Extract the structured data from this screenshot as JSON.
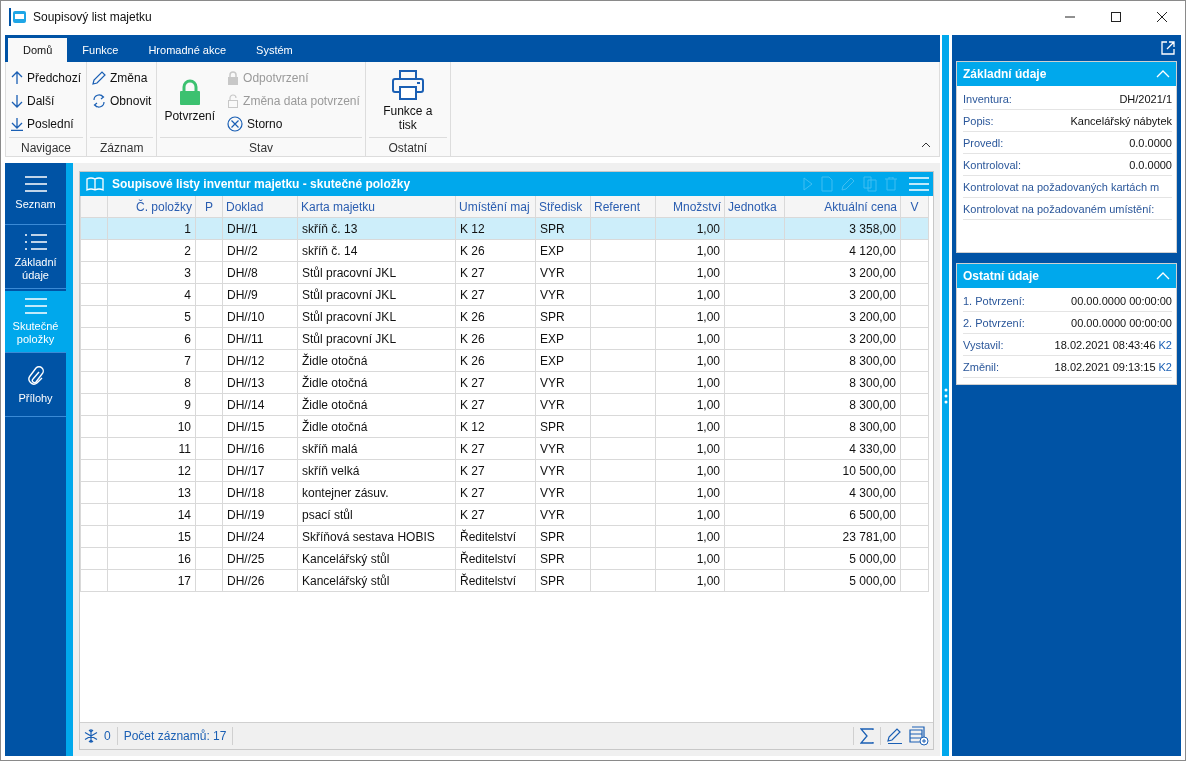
{
  "window": {
    "title": "Soupisový list majetku"
  },
  "tabs": [
    {
      "label": "Domů",
      "selected": true
    },
    {
      "label": "Funkce",
      "selected": false
    },
    {
      "label": "Hromadné akce",
      "selected": false
    },
    {
      "label": "Systém",
      "selected": false
    }
  ],
  "ribbon": {
    "groups": [
      {
        "label": "Navigace",
        "items": [
          {
            "label": "Předchozí",
            "kind": "small",
            "disabled": false
          },
          {
            "label": "Další",
            "kind": "small",
            "disabled": false
          },
          {
            "label": "Poslední",
            "kind": "small",
            "disabled": false
          }
        ]
      },
      {
        "label": "Záznam",
        "items": [
          {
            "label": "Změna",
            "kind": "small",
            "disabled": false
          },
          {
            "label": "Obnovit",
            "kind": "small",
            "disabled": false
          }
        ]
      },
      {
        "label": "Stav",
        "items": [
          {
            "label": "Potvrzení",
            "kind": "large",
            "disabled": false
          },
          {
            "label": "Odpotvrzení",
            "kind": "small",
            "disabled": true
          },
          {
            "label": "Změna data potvrzení",
            "kind": "small",
            "disabled": true
          },
          {
            "label": "Storno",
            "kind": "small",
            "disabled": false
          }
        ]
      },
      {
        "label": "Ostatní",
        "items": [
          {
            "label": "Funkce a tisk",
            "kind": "large",
            "disabled": false
          }
        ]
      }
    ]
  },
  "nav": [
    {
      "label": "Seznam",
      "selected": false
    },
    {
      "label": "Základní údaje",
      "selected": false
    },
    {
      "label": "Skutečné položky",
      "selected": true
    },
    {
      "label": "Přílohy",
      "selected": false
    }
  ],
  "grid": {
    "title": "Soupisové listy inventur majetku - skutečné položky",
    "columns": [
      {
        "label": "Č. položky"
      },
      {
        "label": "P"
      },
      {
        "label": "Doklad"
      },
      {
        "label": "Karta majetku"
      },
      {
        "label": "Umístění maj"
      },
      {
        "label": "Středisk"
      },
      {
        "label": "Referent"
      },
      {
        "label": "Množství"
      },
      {
        "label": "Jednotka"
      },
      {
        "label": "Aktuální cena"
      },
      {
        "label": "V"
      }
    ],
    "rows": [
      {
        "no": "1",
        "doklad": "DH//1",
        "karta": "skříň č. 13",
        "umisteni": "K 12",
        "stredisko": "SPR",
        "mnozstvi": "1,00",
        "cena": "3 358,00",
        "selected": true
      },
      {
        "no": "2",
        "doklad": "DH//2",
        "karta": "skříň č. 14",
        "umisteni": "K 26",
        "stredisko": "EXP",
        "mnozstvi": "1,00",
        "cena": "4 120,00",
        "selected": false
      },
      {
        "no": "3",
        "doklad": "DH//8",
        "karta": "Stůl pracovní JKL",
        "umisteni": "K 27",
        "stredisko": "VYR",
        "mnozstvi": "1,00",
        "cena": "3 200,00",
        "selected": false
      },
      {
        "no": "4",
        "doklad": "DH//9",
        "karta": "Stůl pracovní JKL",
        "umisteni": "K 27",
        "stredisko": "VYR",
        "mnozstvi": "1,00",
        "cena": "3 200,00",
        "selected": false
      },
      {
        "no": "5",
        "doklad": "DH//10",
        "karta": "Stůl pracovní JKL",
        "umisteni": "K 26",
        "stredisko": "SPR",
        "mnozstvi": "1,00",
        "cena": "3 200,00",
        "selected": false
      },
      {
        "no": "6",
        "doklad": "DH//11",
        "karta": "Stůl pracovní JKL",
        "umisteni": "K 26",
        "stredisko": "EXP",
        "mnozstvi": "1,00",
        "cena": "3 200,00",
        "selected": false
      },
      {
        "no": "7",
        "doklad": "DH//12",
        "karta": "Židle otočná",
        "umisteni": "K 26",
        "stredisko": "EXP",
        "mnozstvi": "1,00",
        "cena": "8 300,00",
        "selected": false
      },
      {
        "no": "8",
        "doklad": "DH//13",
        "karta": "Židle otočná",
        "umisteni": "K 27",
        "stredisko": "VYR",
        "mnozstvi": "1,00",
        "cena": "8 300,00",
        "selected": false
      },
      {
        "no": "9",
        "doklad": "DH//14",
        "karta": "Židle otočná",
        "umisteni": "K 27",
        "stredisko": "VYR",
        "mnozstvi": "1,00",
        "cena": "8 300,00",
        "selected": false
      },
      {
        "no": "10",
        "doklad": "DH//15",
        "karta": "Židle otočná",
        "umisteni": "K 12",
        "stredisko": "SPR",
        "mnozstvi": "1,00",
        "cena": "8 300,00",
        "selected": false
      },
      {
        "no": "11",
        "doklad": "DH//16",
        "karta": "skříň malá",
        "umisteni": "K 27",
        "stredisko": "VYR",
        "mnozstvi": "1,00",
        "cena": "4 330,00",
        "selected": false
      },
      {
        "no": "12",
        "doklad": "DH//17",
        "karta": "skříň velká",
        "umisteni": "K 27",
        "stredisko": "VYR",
        "mnozstvi": "1,00",
        "cena": "10 500,00",
        "selected": false
      },
      {
        "no": "13",
        "doklad": "DH//18",
        "karta": "kontejner zásuv.",
        "umisteni": "K 27",
        "stredisko": "VYR",
        "mnozstvi": "1,00",
        "cena": "4 300,00",
        "selected": false
      },
      {
        "no": "14",
        "doklad": "DH//19",
        "karta": "psací stůl",
        "umisteni": "K 27",
        "stredisko": "VYR",
        "mnozstvi": "1,00",
        "cena": "6 500,00",
        "selected": false
      },
      {
        "no": "15",
        "doklad": "DH//24",
        "karta": "Skříňová sestava HOBIS",
        "umisteni": "Ředitelství",
        "stredisko": "SPR",
        "mnozstvi": "1,00",
        "cena": "23 781,00",
        "selected": false
      },
      {
        "no": "16",
        "doklad": "DH//25",
        "karta": "Kancelářský stůl",
        "umisteni": "Ředitelství",
        "stredisko": "SPR",
        "mnozstvi": "1,00",
        "cena": "5 000,00",
        "selected": false
      },
      {
        "no": "17",
        "doklad": "DH//26",
        "karta": "Kancelářský stůl",
        "umisteni": "Ředitelství",
        "stredisko": "SPR",
        "mnozstvi": "1,00",
        "cena": "5 000,00",
        "selected": false
      }
    ],
    "status": {
      "filter_count": "0",
      "record_count": "Počet záznamů: 17"
    }
  },
  "side": [
    {
      "title": "Základní údaje",
      "expanded": true,
      "fields": [
        {
          "label": "Inventura:",
          "value": "DH/2021/1"
        },
        {
          "label": "Popis:",
          "value": "Kancelářský nábytek"
        },
        {
          "label": "Provedl:",
          "value": "0.0.0000"
        },
        {
          "label": "Kontroloval:",
          "value": "0.0.0000"
        },
        {
          "label": "Kontrolovat na požadovaných kartách m"
        },
        {
          "label": "Kontrolovat na požadovaném umístění:"
        }
      ]
    },
    {
      "title": "Ostatní údaje",
      "expanded": true,
      "fields": [
        {
          "label": "1. Potvrzení:",
          "value": "00.00.0000 00:00:00"
        },
        {
          "label": "2. Potvrzení:",
          "value": "00.00.0000 00:00:00"
        },
        {
          "label": "Vystavil:",
          "value": "18.02.2021 08:43:46",
          "user": "K2"
        },
        {
          "label": "Změnil:",
          "value": "18.02.2021 09:13:15",
          "user": "K2"
        }
      ]
    }
  ]
}
